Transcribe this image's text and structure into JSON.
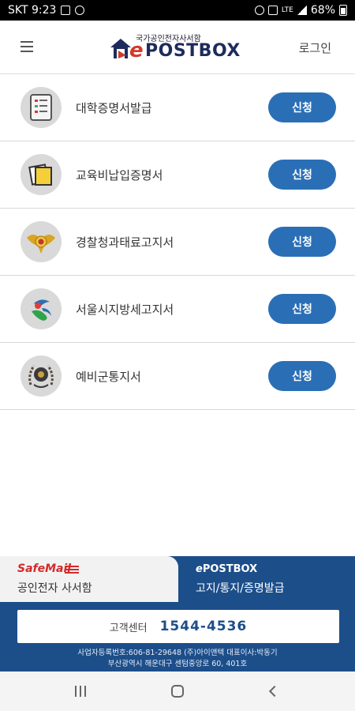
{
  "status_bar": {
    "carrier_time": "SKT 9:23",
    "network": "LTE",
    "battery": "68%"
  },
  "header": {
    "logo_sub": "국가공인전자사서함",
    "logo_e": "e",
    "logo_word": "POSTBOX",
    "login_label": "로그인"
  },
  "items": [
    {
      "label": "대학증명서발급",
      "button": "신청",
      "icon": "document-list-icon"
    },
    {
      "label": "교육비납입증명서",
      "button": "신청",
      "icon": "stacked-papers-icon"
    },
    {
      "label": "경찰청과태료고지서",
      "button": "신청",
      "icon": "police-emblem-icon"
    },
    {
      "label": "서울시지방세고지서",
      "button": "신청",
      "icon": "seoul-logo-icon"
    },
    {
      "label": "예비군통지서",
      "button": "신청",
      "icon": "reserve-forces-emblem-icon"
    }
  ],
  "tabs": {
    "left_brand": "SafeMail",
    "left_label": "공인전자 사서함",
    "right_brand": "POSTBOX",
    "right_brand_e": "e",
    "right_label": "고지/통지/증명발급"
  },
  "footer": {
    "cs_label": "고객센터",
    "cs_phone": "1544-4536",
    "biz_line1": "사업자등록번호:606-81-29648 (주)아이앤텍 대표이사:박동기",
    "biz_line2": "부산광역시 해운대구 센텀중앙로 60, 401호"
  },
  "colors": {
    "accent": "#2a6fb6",
    "brand_navy": "#1c4e8a",
    "logo_red": "#d23a2b"
  }
}
